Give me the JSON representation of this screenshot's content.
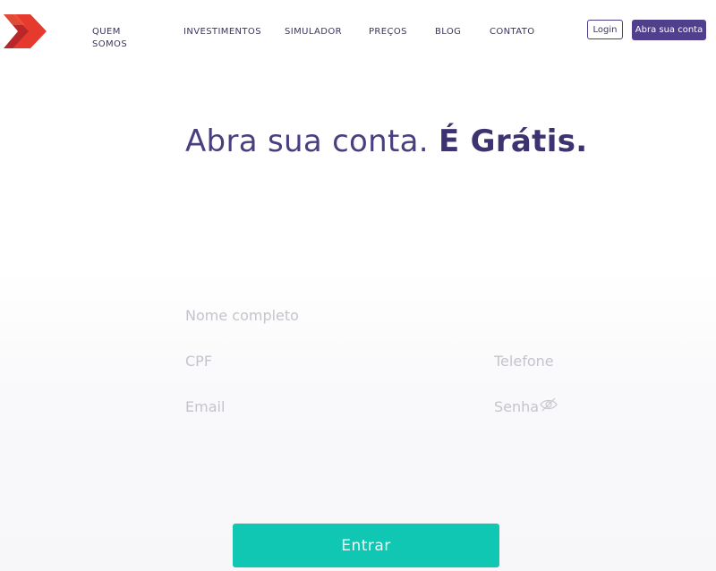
{
  "header": {
    "logo": {
      "icon": "arrow-chevrons-logo",
      "colors": [
        "#e63a2e",
        "#b8282b"
      ]
    },
    "nav": [
      {
        "label": "QUEM SOMOS"
      },
      {
        "label": "INVESTIMENTOS"
      },
      {
        "label": "SIMULADOR"
      },
      {
        "label": "PREÇOS"
      },
      {
        "label": "BLOG"
      },
      {
        "label": "CONTATO"
      }
    ],
    "login_label": "Login",
    "signup_label": "Abra sua conta"
  },
  "hero": {
    "title_regular": "Abra sua conta.",
    "title_bold": "É Grátis."
  },
  "form": {
    "name_placeholder": "Nome completo",
    "cpf_placeholder": "CPF",
    "phone_placeholder": "Telefone",
    "email_placeholder": "Email",
    "password_placeholder": "Senha",
    "password_toggle_icon": "eye-slash-icon",
    "submit_label": "Entrar"
  },
  "colors": {
    "brand_purple": "#4f3f8c",
    "submit_teal": "#10c7b3",
    "logo_red": "#e63a2e"
  }
}
